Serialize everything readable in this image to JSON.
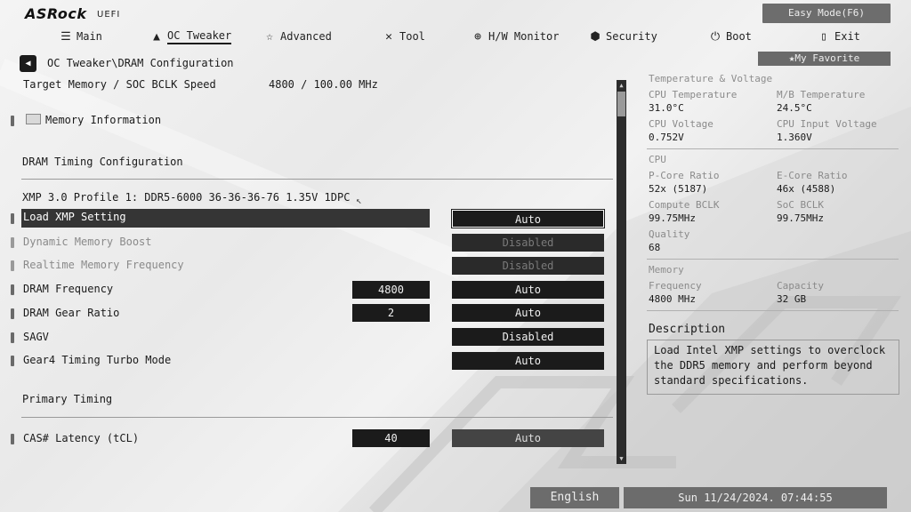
{
  "header": {
    "brand": "ASRock",
    "brand_suffix": "UEFI",
    "easy_mode": "Easy Mode(F6)",
    "favorite": "My Favorite",
    "tabs": [
      {
        "label": "Main",
        "icon": "list-icon"
      },
      {
        "label": "OC Tweaker",
        "icon": "rocket-icon",
        "active": true
      },
      {
        "label": "Advanced",
        "icon": "star-icon"
      },
      {
        "label": "Tool",
        "icon": "tools-icon"
      },
      {
        "label": "H/W Monitor",
        "icon": "crosshair-icon"
      },
      {
        "label": "Security",
        "icon": "shield-icon"
      },
      {
        "label": "Boot",
        "icon": "power-icon"
      },
      {
        "label": "Exit",
        "icon": "exit-door-icon"
      }
    ]
  },
  "left": {
    "breadcrumb": "OC Tweaker\\DRAM Configuration",
    "target_label": "Target Memory / SOC BCLK Speed",
    "target_value": "4800 / 100.00 MHz",
    "memory_info": "Memory Information",
    "dram_timing": "DRAM Timing Configuration",
    "xmp_profile": "XMP 3.0 Profile 1: DDR5-6000 36-36-36-76 1.35V 1DPC",
    "primary_timing": "Primary Timing",
    "settings": [
      {
        "label": "Load XMP Setting",
        "option": "Auto",
        "num": ""
      },
      {
        "label": "Dynamic Memory Boost",
        "option": "Disabled",
        "num": ""
      },
      {
        "label": "Realtime Memory Frequency",
        "option": "Disabled",
        "num": ""
      },
      {
        "label": "DRAM Frequency",
        "option": "Auto",
        "num": "4800"
      },
      {
        "label": "DRAM Gear Ratio",
        "option": "Auto",
        "num": "2"
      },
      {
        "label": "SAGV",
        "option": "Disabled",
        "num": ""
      },
      {
        "label": "Gear4 Timing Turbo Mode",
        "option": "Auto",
        "num": ""
      },
      {
        "label": "CAS# Latency (tCL)",
        "option": "Auto",
        "num": "40"
      }
    ]
  },
  "right": {
    "temp_voltage_title": "Temperature & Voltage",
    "cpu_temp_label": "CPU Temperature",
    "cpu_temp_value": "31.0°C",
    "mb_temp_label": "M/B Temperature",
    "mb_temp_value": "24.5°C",
    "cpu_volt_label": "CPU Voltage",
    "cpu_volt_value": "0.752V",
    "cpu_input_label": "CPU Input Voltage",
    "cpu_input_value": "1.360V",
    "cpu_title": "CPU",
    "pcore_label": "P-Core Ratio",
    "pcore_value": "52x (5187)",
    "ecore_label": "E-Core Ratio",
    "ecore_value": "46x (4588)",
    "compute_label": "Compute BCLK",
    "compute_value": "99.75MHz",
    "soc_label": "SoC BCLK",
    "soc_value": "99.75MHz",
    "quality_label": "Quality",
    "quality_value": "68",
    "memory_title": "Memory",
    "freq_label": "Frequency",
    "freq_value": "4800 MHz",
    "cap_label": "Capacity",
    "cap_value": "32 GB",
    "desc_title": "Description",
    "desc_lines": [
      "Load Intel XMP settings to overclock",
      "the DDR5 memory and perform beyond",
      "standard specifications."
    ]
  },
  "footer": {
    "language": "English",
    "datetime": "Sun 11/24/2024. 07:44:55"
  },
  "colors": {
    "highlight_row": "#353535",
    "value_box": "#1b1b1b",
    "footer_button": "#6c6c6c"
  }
}
